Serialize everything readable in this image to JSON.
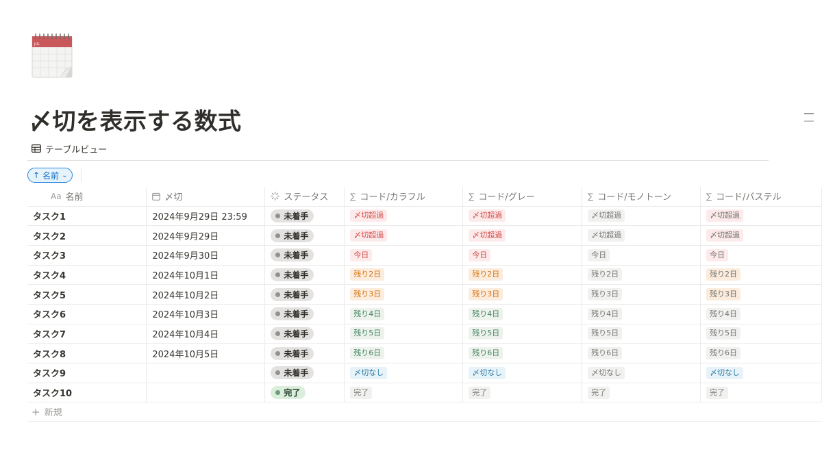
{
  "page": {
    "icon": "calendar-icon",
    "icon_month": "JUL",
    "title": "〆切を表示する数式"
  },
  "view": {
    "tab_icon": "table-icon",
    "tab_label": "テーブルビュー",
    "sort_chip": {
      "arrow": "↑",
      "label": "名前",
      "chevron": "⌄"
    }
  },
  "table": {
    "columns": [
      {
        "icon_text": "Aa",
        "label": "名前"
      },
      {
        "icon_text": "▭",
        "label": "〆切"
      },
      {
        "icon_text": "◌",
        "label": "ステータス"
      },
      {
        "icon_text": "∑",
        "label": "コード/カラフル"
      },
      {
        "icon_text": "∑",
        "label": "コード/グレー"
      },
      {
        "icon_text": "∑",
        "label": "コード/モノトーン"
      },
      {
        "icon_text": "∑",
        "label": "コード/パステル"
      }
    ],
    "rows": [
      {
        "name": "タスク1",
        "date": "2024年9月29日 23:59",
        "status": "未着手",
        "colorful": "〆切超過",
        "gray": "〆切超過",
        "mono": "〆切超過",
        "pastel": "〆切超過"
      },
      {
        "name": "タスク2",
        "date": "2024年9月29日",
        "status": "未着手",
        "colorful": "〆切超過",
        "gray": "〆切超過",
        "mono": "〆切超過",
        "pastel": "〆切超過"
      },
      {
        "name": "タスク3",
        "date": "2024年9月30日",
        "status": "未着手",
        "colorful": "今日",
        "gray": "今日",
        "mono": "今日",
        "pastel": "今日"
      },
      {
        "name": "タスク4",
        "date": "2024年10月1日",
        "status": "未着手",
        "colorful": "残り2日",
        "gray": "残り2日",
        "mono": "残り2日",
        "pastel": "残り2日"
      },
      {
        "name": "タスク5",
        "date": "2024年10月2日",
        "status": "未着手",
        "colorful": "残り3日",
        "gray": "残り3日",
        "mono": "残り3日",
        "pastel": "残り3日"
      },
      {
        "name": "タスク6",
        "date": "2024年10月3日",
        "status": "未着手",
        "colorful": "残り4日",
        "gray": "残り4日",
        "mono": "残り4日",
        "pastel": "残り4日"
      },
      {
        "name": "タスク7",
        "date": "2024年10月4日",
        "status": "未着手",
        "colorful": "残り5日",
        "gray": "残り5日",
        "mono": "残り5日",
        "pastel": "残り5日"
      },
      {
        "name": "タスク8",
        "date": "2024年10月5日",
        "status": "未着手",
        "colorful": "残り6日",
        "gray": "残り6日",
        "mono": "残り6日",
        "pastel": "残り6日"
      },
      {
        "name": "タスク9",
        "date": "",
        "status": "未着手",
        "colorful": "〆切なし",
        "gray": "〆切なし",
        "mono": "〆切なし",
        "pastel": "〆切なし"
      },
      {
        "name": "タスク10",
        "date": "",
        "status": "完了",
        "colorful": "完了",
        "gray": "完了",
        "mono": "完了",
        "pastel": "完了"
      }
    ],
    "new_row_label": "新規"
  },
  "colors": {
    "accent": "#2383e2",
    "overdue": "#d44c47",
    "soon": "#d9730d",
    "later": "#448361",
    "none": "#337ea9",
    "neutral": "#787774"
  }
}
